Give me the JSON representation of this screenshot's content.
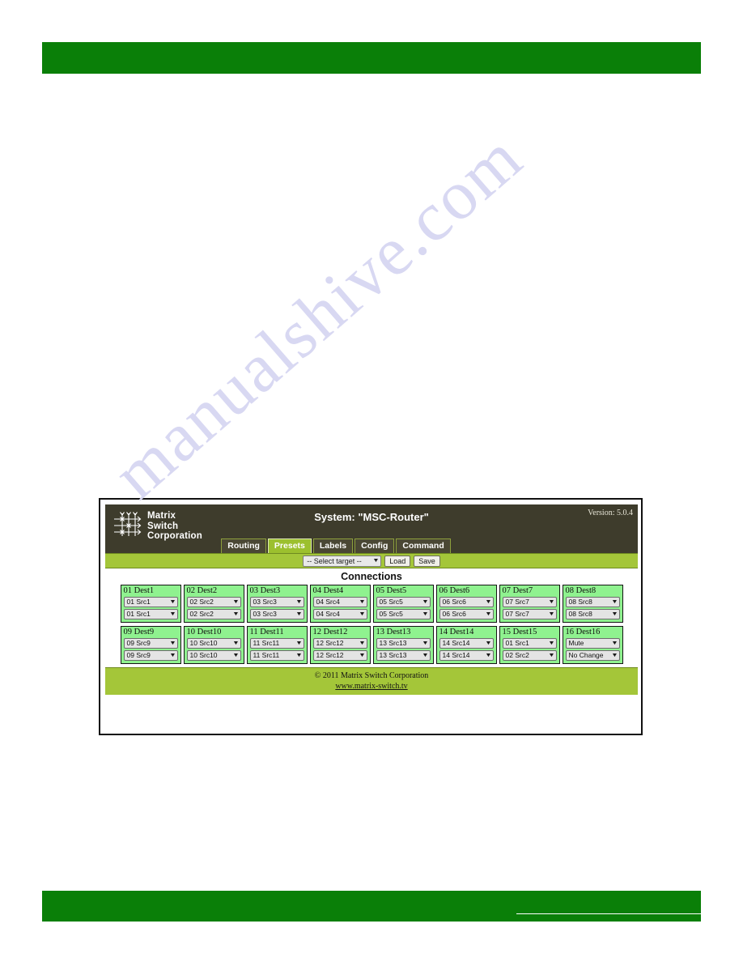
{
  "page": {
    "watermark": "manualshive.com",
    "band_color": "#0a7f08"
  },
  "app": {
    "header": {
      "logo": {
        "icon": "matrix-crosspoint-logo-icon",
        "line1": "Matrix",
        "line2": "Switch",
        "line3": "Corporation"
      },
      "system_title": "System: \"MSC-Router\"",
      "version": "Version: 5.0.4"
    },
    "tabs": [
      {
        "label": "Routing",
        "active": false
      },
      {
        "label": "Presets",
        "active": true
      },
      {
        "label": "Labels",
        "active": false
      },
      {
        "label": "Config",
        "active": false
      },
      {
        "label": "Command",
        "active": false
      }
    ],
    "toolbar": {
      "target_select": {
        "value": "-- Select target --",
        "caret": "▼"
      },
      "load_label": "Load",
      "save_label": "Save"
    },
    "content": {
      "title": "Connections",
      "caret": "▼",
      "rows": [
        [
          {
            "label": "01 Dest1",
            "video": "01 Src1",
            "audio": "01 Src1"
          },
          {
            "label": "02 Dest2",
            "video": "02 Src2",
            "audio": "02 Src2"
          },
          {
            "label": "03 Dest3",
            "video": "03 Src3",
            "audio": "03 Src3"
          },
          {
            "label": "04 Dest4",
            "video": "04 Src4",
            "audio": "04 Src4"
          },
          {
            "label": "05 Dest5",
            "video": "05 Src5",
            "audio": "05 Src5"
          },
          {
            "label": "06 Dest6",
            "video": "06 Src6",
            "audio": "06 Src6"
          },
          {
            "label": "07 Dest7",
            "video": "07 Src7",
            "audio": "07 Src7"
          },
          {
            "label": "08 Dest8",
            "video": "08 Src8",
            "audio": "08 Src8"
          }
        ],
        [
          {
            "label": "09 Dest9",
            "video": "09 Src9",
            "audio": "09 Src9"
          },
          {
            "label": "10 Dest10",
            "video": "10 Src10",
            "audio": "10 Src10"
          },
          {
            "label": "11 Dest11",
            "video": "11 Src11",
            "audio": "11 Src11"
          },
          {
            "label": "12 Dest12",
            "video": "12 Src12",
            "audio": "12 Src12"
          },
          {
            "label": "13 Dest13",
            "video": "13 Src13",
            "audio": "13 Src13"
          },
          {
            "label": "14 Dest14",
            "video": "14 Src14",
            "audio": "14 Src14"
          },
          {
            "label": "15 Dest15",
            "video": "01 Src1",
            "audio": "02 Src2"
          },
          {
            "label": "16 Dest16",
            "video": "Mute",
            "audio": "No Change"
          }
        ]
      ]
    },
    "footer": {
      "copyright": "© 2011 Matrix Switch Corporation",
      "link_text": "www.matrix-switch.tv"
    }
  }
}
